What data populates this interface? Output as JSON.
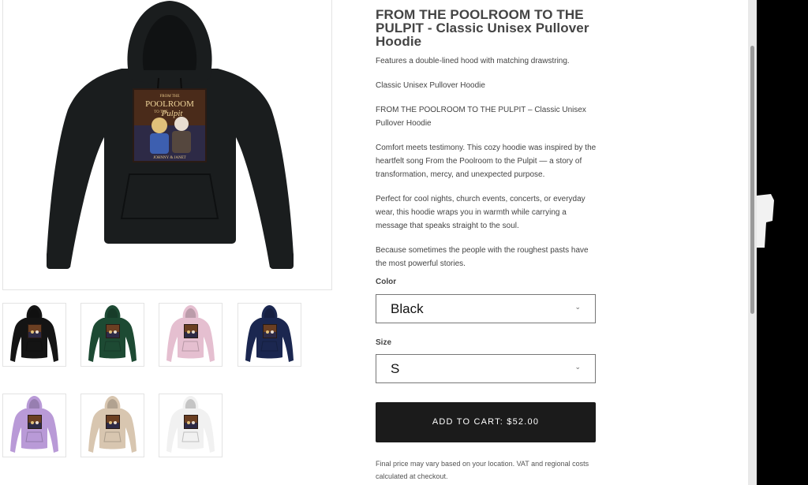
{
  "product": {
    "title": "FROM THE POOLROOM TO THE PULPIT - Classic Unisex Pullover Hoodie",
    "description": [
      "Features a double-lined hood with matching drawstring.",
      "Classic Unisex Pullover Hoodie",
      "FROM THE POOLROOM TO THE PULPIT – Classic Unisex Pullover Hoodie",
      "Comfort meets testimony. This cozy hoodie was inspired by the heartfelt song From the Poolroom to the Pulpit — a story of transformation, mercy, and unexpected purpose.",
      "Perfect for cool nights, church events, concerts, or everyday wear, this hoodie wraps you in warmth while carrying a message that speaks straight to the soul.",
      "Because sometimes the people with the roughest pasts have the most powerful stories."
    ],
    "print": {
      "line1": "FROM THE",
      "line2": "POOLROOM",
      "line3": "TO THE",
      "line4": "Pulpit",
      "names": "JOHNNY & JANET"
    }
  },
  "options": {
    "color_label": "Color",
    "color_value": "Black",
    "size_label": "Size",
    "size_value": "S"
  },
  "cart": {
    "label": "ADD TO CART: $52.00"
  },
  "note": "Final price may vary based on your location. VAT and regional costs calculated at checkout.",
  "thumbnails": [
    {
      "color": "#141414",
      "name": "black"
    },
    {
      "color": "#1d4a33",
      "name": "forest-green"
    },
    {
      "color": "#e5bfd0",
      "name": "pink"
    },
    {
      "color": "#1b2750",
      "name": "navy"
    },
    {
      "color": "#b99ad7",
      "name": "lavender"
    },
    {
      "color": "#d8c6b0",
      "name": "sand"
    },
    {
      "color": "#f1f1f1",
      "name": "white"
    }
  ],
  "main_hoodie_color": "#1a1d1e",
  "icons": {
    "chevron": "chevron-down-icon"
  }
}
